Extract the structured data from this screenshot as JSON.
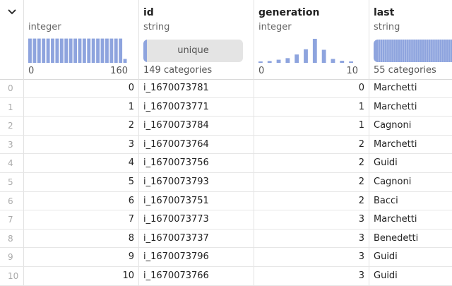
{
  "columns": [
    {
      "key": "index",
      "type": "integer",
      "min": "0",
      "max": "160",
      "hist": [
        0.93,
        0.93,
        0.93,
        0.93,
        0.93,
        0.93,
        0.93,
        0.93,
        0.93,
        0.93,
        0.93,
        0.93,
        0.93,
        0.93,
        0.93,
        0.93,
        0.93,
        0.93,
        0.93,
        0.93,
        0.93,
        0.15
      ]
    },
    {
      "key": "id",
      "name": "id",
      "type": "string",
      "unique_label": "unique",
      "categories": "149 categories"
    },
    {
      "key": "generation",
      "name": "generation",
      "type": "integer",
      "min": "0",
      "max": "10",
      "hist": [
        0.05,
        0.07,
        0.12,
        0.18,
        0.32,
        0.52,
        0.92,
        0.5,
        0.15,
        0.08,
        0.05
      ]
    },
    {
      "key": "last",
      "name": "last",
      "type": "string",
      "categories": "55 categories"
    }
  ],
  "rows": [
    {
      "i": "0",
      "index": "0",
      "id": "i_1670073781",
      "generation": "0",
      "last": "Marchetti"
    },
    {
      "i": "1",
      "index": "1",
      "id": "i_1670073771",
      "generation": "1",
      "last": "Marchetti"
    },
    {
      "i": "2",
      "index": "2",
      "id": "i_1670073784",
      "generation": "1",
      "last": "Cagnoni"
    },
    {
      "i": "3",
      "index": "3",
      "id": "i_1670073764",
      "generation": "2",
      "last": "Marchetti"
    },
    {
      "i": "4",
      "index": "4",
      "id": "i_1670073756",
      "generation": "2",
      "last": "Guidi"
    },
    {
      "i": "5",
      "index": "5",
      "id": "i_1670073793",
      "generation": "2",
      "last": "Cagnoni"
    },
    {
      "i": "6",
      "index": "6",
      "id": "i_1670073751",
      "generation": "2",
      "last": "Bacci"
    },
    {
      "i": "7",
      "index": "7",
      "id": "i_1670073773",
      "generation": "3",
      "last": "Marchetti"
    },
    {
      "i": "8",
      "index": "8",
      "id": "i_1670073737",
      "generation": "3",
      "last": "Benedetti"
    },
    {
      "i": "9",
      "index": "9",
      "id": "i_1670073796",
      "generation": "3",
      "last": "Guidi"
    },
    {
      "i": "10",
      "index": "10",
      "id": "i_1670073766",
      "generation": "3",
      "last": "Guidi"
    }
  ],
  "colors": {
    "bar": "#8ea4de",
    "unique_bg": "#e4e4e4",
    "border": "#e2e2e2"
  }
}
